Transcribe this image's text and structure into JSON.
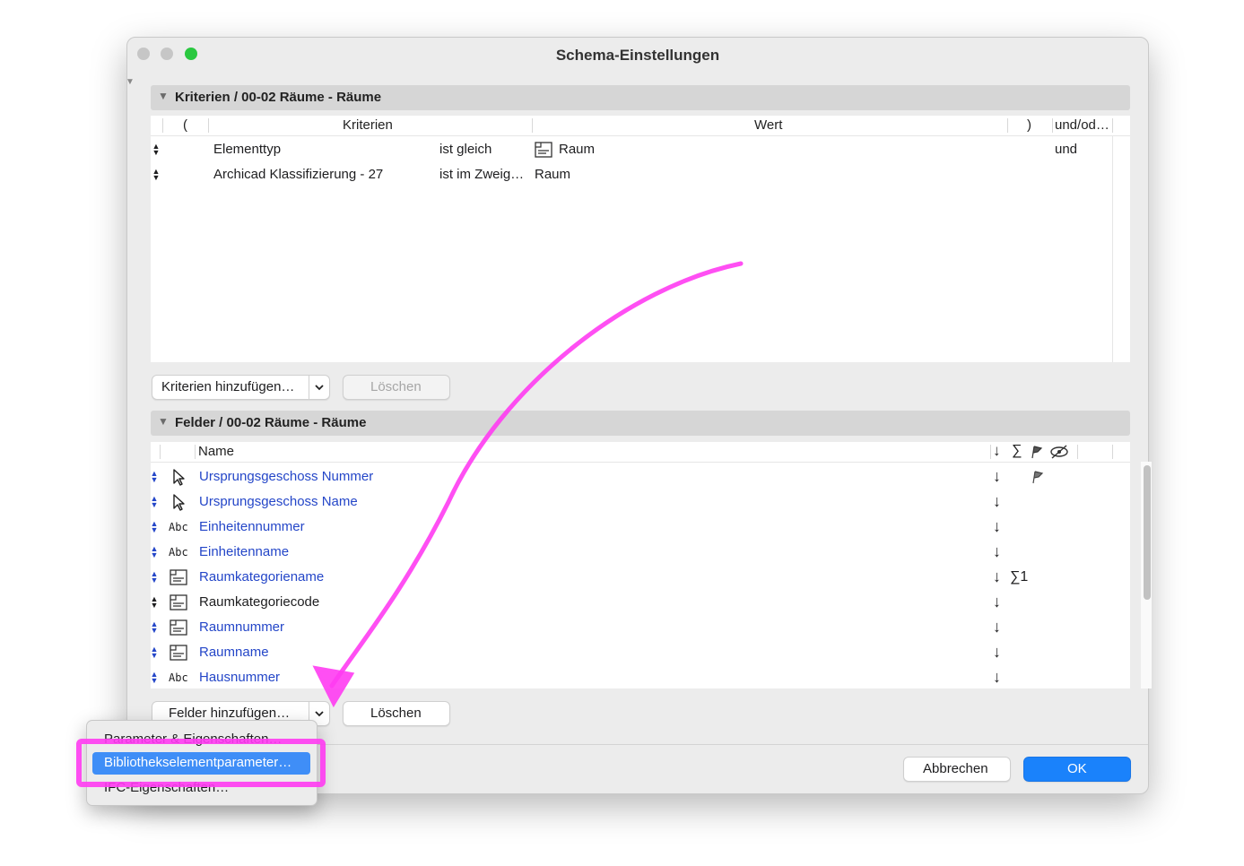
{
  "window": {
    "title": "Schema-Einstellungen",
    "traffic_lights": [
      "#c6c6c6",
      "#c6c6c6",
      "#2ac840"
    ]
  },
  "criteria": {
    "header": "Kriterien / 00-02 Räume - Räume",
    "columns": {
      "open": "(",
      "criteria": "Kriterien",
      "value": "Wert",
      "close": ")",
      "andor": "und/od…"
    },
    "rows": [
      {
        "name": "Elementtyp",
        "op": "ist gleich",
        "value_icon": "room-stamp-icon",
        "value": "Raum",
        "andor": "und"
      },
      {
        "name": "Archicad Klassifizierung - 27",
        "op": "ist im Zweig…",
        "value": "Raum",
        "andor": ""
      }
    ],
    "add_button": "Kriterien hinzufügen…",
    "delete_button": "Löschen"
  },
  "fields": {
    "header": "Felder / 00-02 Räume - Räume",
    "columns": {
      "name": "Name",
      "sort": "↓",
      "sum": "∑"
    },
    "rows": [
      {
        "name": "Ursprungsgeschoss Nummer",
        "icon": "cursor-arrow-icon",
        "sort": "↓",
        "sum": "",
        "flag": true,
        "linked": true
      },
      {
        "name": "Ursprungsgeschoss Name",
        "icon": "cursor-arrow-icon",
        "sort": "↓",
        "sum": "",
        "flag": false,
        "linked": true
      },
      {
        "name": "Einheitennummer",
        "icon": "abc-text-icon",
        "icon_text": "Abc",
        "sort": "↓",
        "sum": "",
        "flag": false,
        "linked": true
      },
      {
        "name": "Einheitenname",
        "icon": "abc-text-icon",
        "icon_text": "Abc",
        "sort": "↓",
        "sum": "",
        "flag": false,
        "linked": true
      },
      {
        "name": "Raumkategoriename",
        "icon": "room-stamp-icon",
        "sort": "↓",
        "sum": "∑1",
        "flag": false,
        "linked": true
      },
      {
        "name": "Raumkategoriecode",
        "icon": "room-stamp-icon",
        "sort": "↓",
        "sum": "",
        "flag": false,
        "linked": false
      },
      {
        "name": "Raumnummer",
        "icon": "room-stamp-icon",
        "sort": "↓",
        "sum": "",
        "flag": false,
        "linked": true
      },
      {
        "name": "Raumname",
        "icon": "room-stamp-icon",
        "sort": "↓",
        "sum": "",
        "flag": false,
        "linked": true
      },
      {
        "name": "Hausnummer",
        "icon": "abc-text-icon",
        "icon_text": "Abc",
        "sort": "↓",
        "sum": "",
        "flag": false,
        "linked": true
      }
    ],
    "add_button": "Felder hinzufügen…",
    "delete_button": "Löschen"
  },
  "footer": {
    "cancel": "Abbrechen",
    "ok": "OK"
  },
  "dropdown_menu": {
    "items": [
      "Parameter & Eigenschaften…",
      "Bibliothekselementparameter…",
      "IFC-Eigenschaften…"
    ],
    "selected_index": 1
  },
  "colors": {
    "accent": "#1a82fb",
    "link_text": "#2446c8",
    "annotation": "#ff3cf2",
    "menu_highlight": "#3f8ef7"
  }
}
